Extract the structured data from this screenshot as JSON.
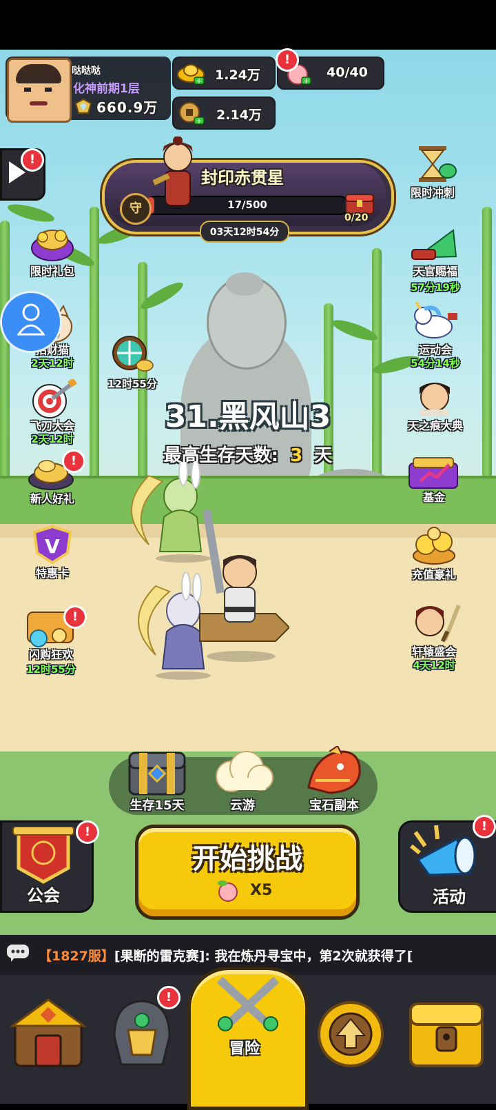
{
  "player": {
    "name": "哒哒哒",
    "realm": "化神前期1层",
    "power": "660.9万"
  },
  "currency": {
    "gold": "1.24万",
    "stamina": "40/40",
    "coins": "2.14万"
  },
  "event": {
    "title": "封印赤贯星",
    "shield_glyph": "守",
    "progress_text": "17/500",
    "progress_fraction": 0.034,
    "chest_count": "0/20",
    "timer": "03天12时54分"
  },
  "left_menu": [
    {
      "label": "限时礼包",
      "timer": ""
    },
    {
      "label": "招财猫",
      "timer": "2天12时"
    },
    {
      "label": "飞刀大会",
      "timer": "2天12时"
    },
    {
      "label": "新人好礼",
      "timer": ""
    },
    {
      "label": "特惠卡",
      "timer": ""
    },
    {
      "label": "闪购狂欢",
      "timer": "12时55分"
    }
  ],
  "right_menu": [
    {
      "label": "限时冲刺",
      "timer": ""
    },
    {
      "label": "天官赐福",
      "timer": "57分19秒"
    },
    {
      "label": "运动会",
      "timer": "54分14秒"
    },
    {
      "label": "天之痕大典",
      "timer": ""
    },
    {
      "label": "基金",
      "timer": ""
    },
    {
      "label": "充值豪礼",
      "timer": ""
    },
    {
      "label": "轩辕盛会",
      "timer": "4天12时"
    }
  ],
  "wheel_timer": "12时55分",
  "stage": {
    "name": "31.黑风山3",
    "survival_label": "最高生存天数:",
    "survival_value": "3",
    "survival_unit": "天"
  },
  "modes": [
    {
      "label": "生存15天"
    },
    {
      "label": "云游"
    },
    {
      "label": "宝石副本"
    }
  ],
  "guild_label": "公会",
  "activity_label": "活动",
  "start": {
    "label": "开始挑战",
    "cost": "X5"
  },
  "chat": {
    "server": "【1827服】",
    "message": "[果断的雷克赛]: 我在炼丹寻宝中，第2次就获得了["
  },
  "bottom_nav": {
    "active_label": "冒险"
  }
}
